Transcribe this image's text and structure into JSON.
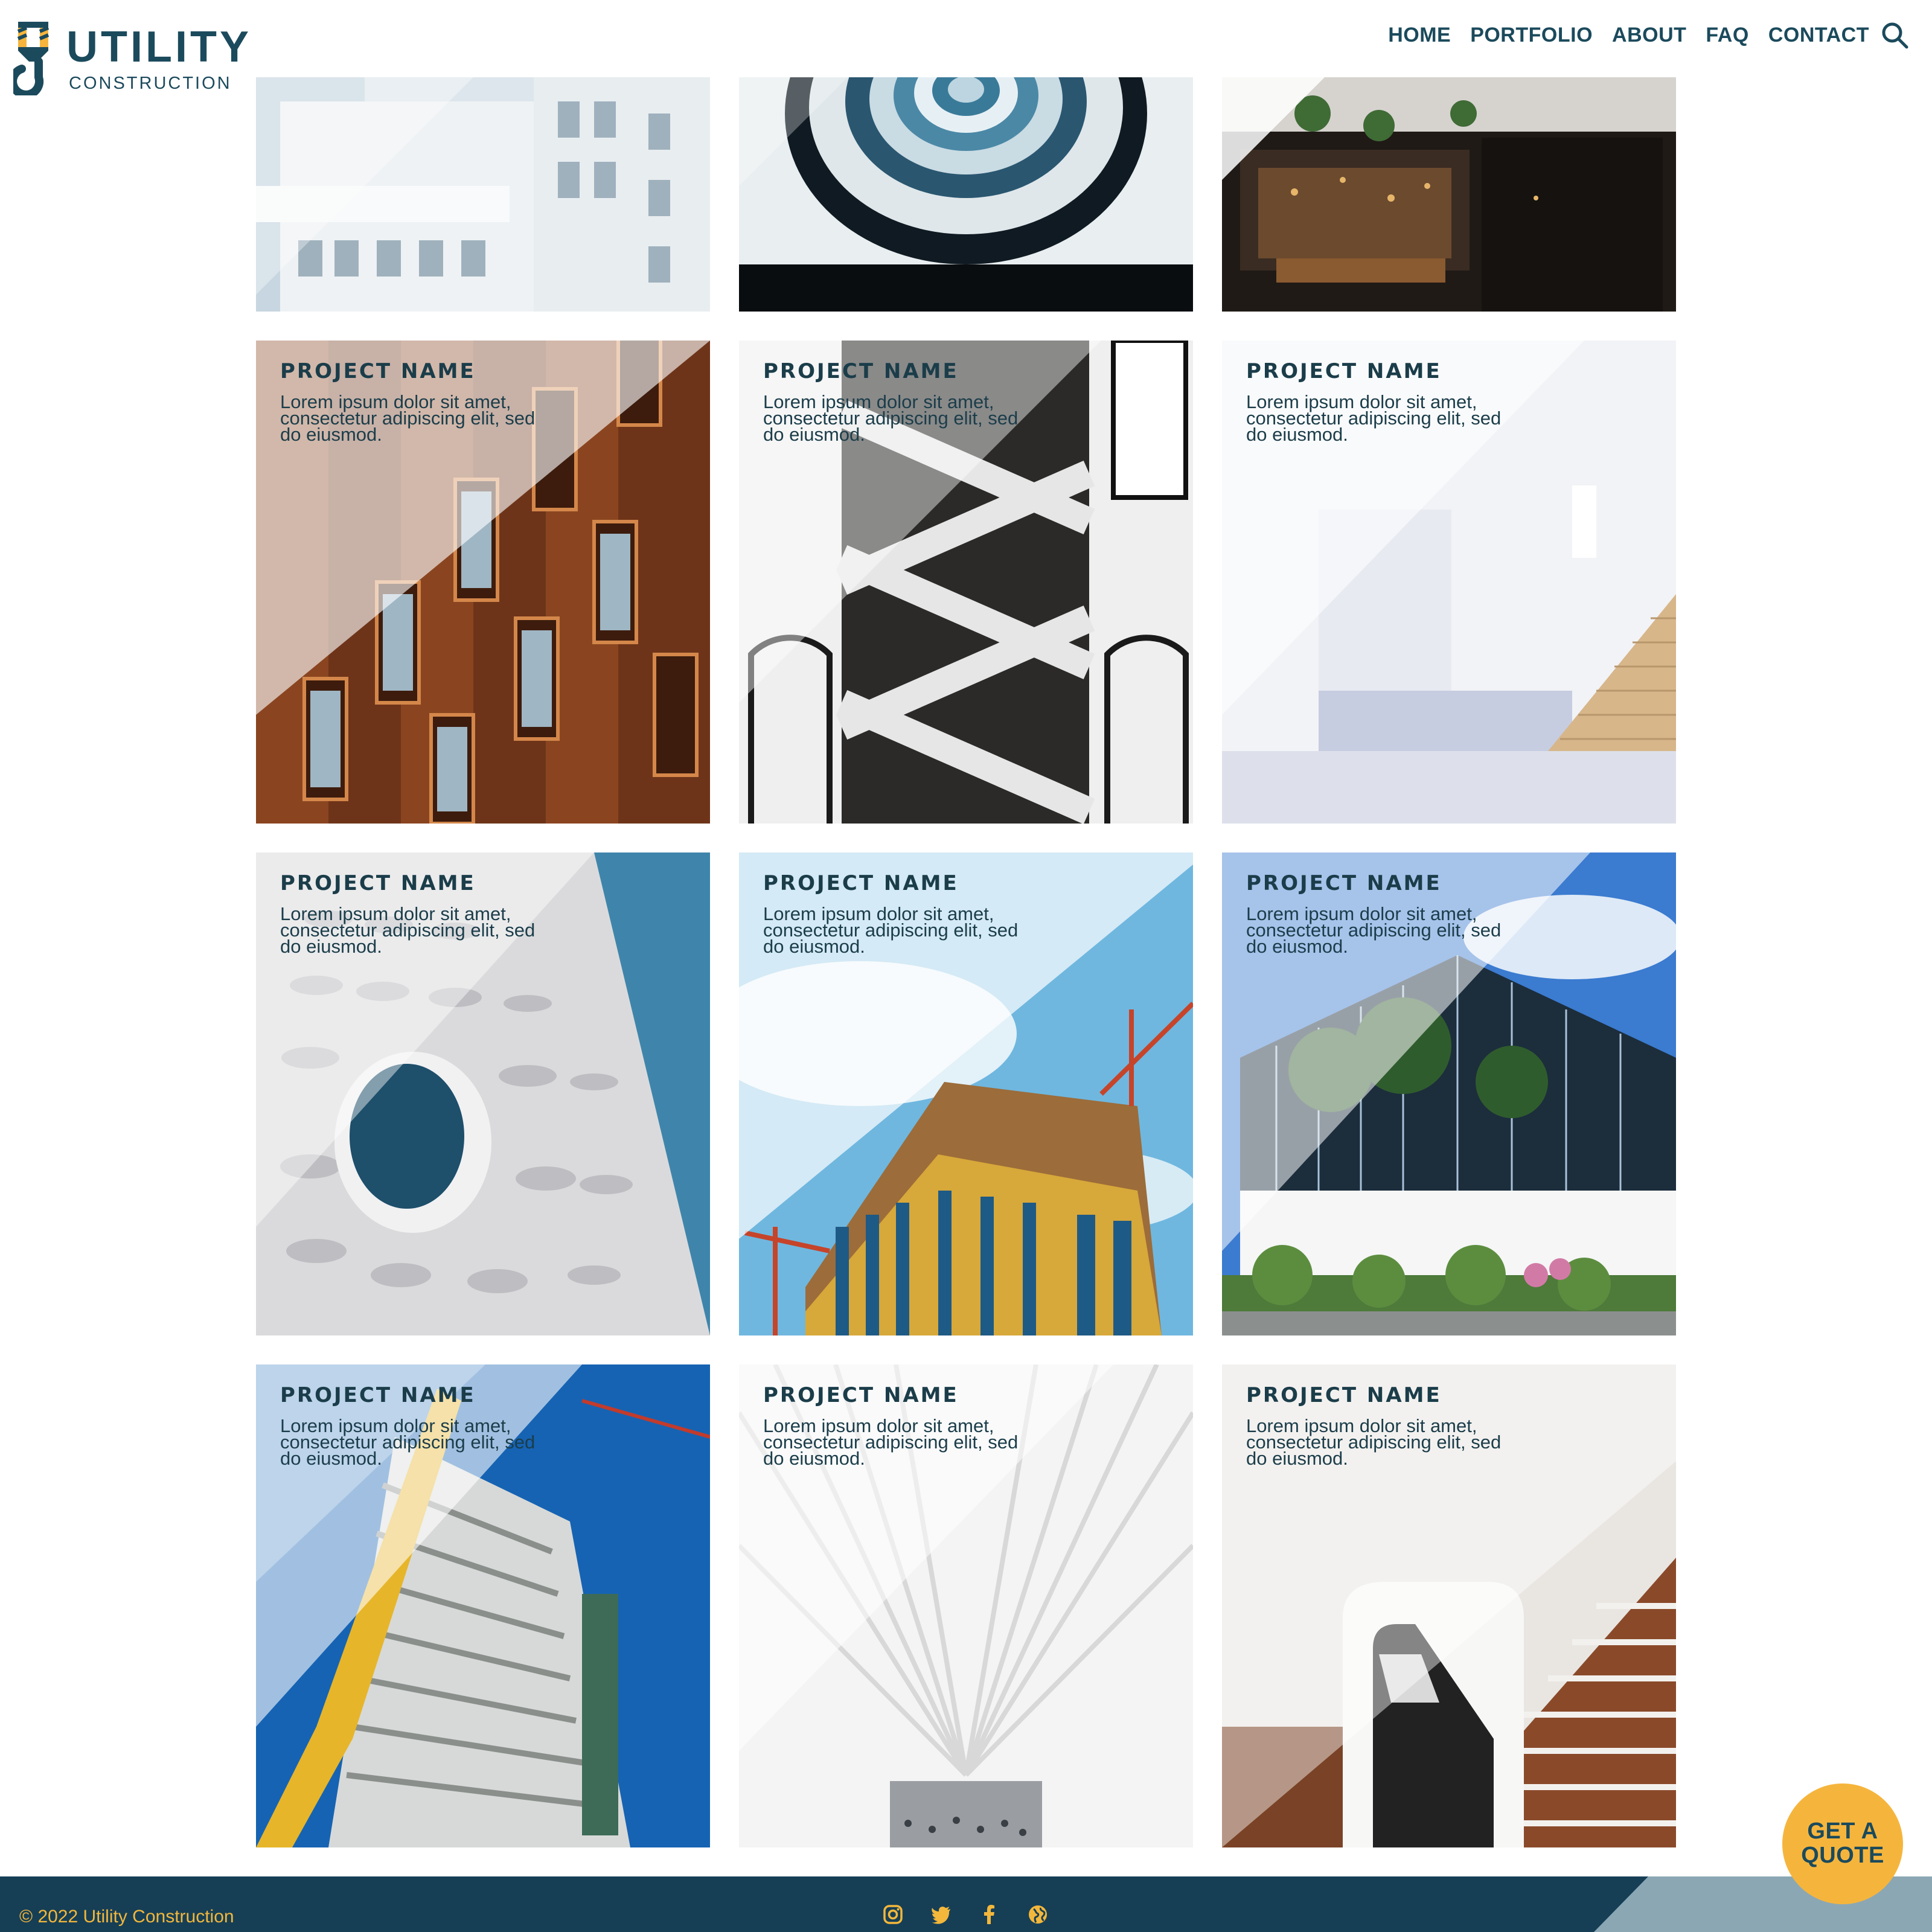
{
  "brand": {
    "title": "UTILITY",
    "subtitle": "CONSTRUCTION",
    "primary_color": "#1b4a5c",
    "accent_color": "#f5b53d"
  },
  "nav": {
    "items": [
      "HOME",
      "PORTFOLIO",
      "ABOUT",
      "FAQ",
      "CONTACT"
    ],
    "search_icon": "search-icon"
  },
  "projects": {
    "top_row": [
      {
        "alt": "white modular building facade"
      },
      {
        "alt": "spiral staircase from below"
      },
      {
        "alt": "restaurant interior atrium"
      }
    ],
    "tiles": [
      {
        "name": "PROJECT NAME",
        "description": "Lorem ipsum dolor sit amet, consectetur adipiscing elit, sed do eiusmod."
      },
      {
        "name": "PROJECT NAME",
        "description": "Lorem ipsum dolor sit amet, consectetur adipiscing elit, sed do eiusmod."
      },
      {
        "name": "PROJECT NAME",
        "description": "Lorem ipsum dolor sit amet, consectetur adipiscing elit, sed do eiusmod."
      },
      {
        "name": "PROJECT NAME",
        "description": "Lorem ipsum dolor sit amet, consectetur adipiscing elit, sed do eiusmod."
      },
      {
        "name": "PROJECT NAME",
        "description": "Lorem ipsum dolor sit amet, consectetur adipiscing elit, sed do eiusmod."
      },
      {
        "name": "PROJECT NAME",
        "description": "Lorem ipsum dolor sit amet, consectetur adipiscing elit, sed do eiusmod."
      },
      {
        "name": "PROJECT NAME",
        "description": "Lorem ipsum dolor sit amet, consectetur adipiscing elit, sed do eiusmod."
      },
      {
        "name": "PROJECT NAME",
        "description": "Lorem ipsum dolor sit amet, consectetur adipiscing elit, sed do eiusmod."
      },
      {
        "name": "PROJECT NAME",
        "description": "Lorem ipsum dolor sit amet, consectetur adipiscing elit, sed do eiusmod."
      }
    ]
  },
  "cta": {
    "line1": "GET A",
    "line2": "QUOTE"
  },
  "footer": {
    "copyright": "© 2022 Utility Construction",
    "socials": [
      "instagram-icon",
      "twitter-icon",
      "facebook-icon",
      "globe-icon"
    ],
    "background": "#163f56"
  }
}
